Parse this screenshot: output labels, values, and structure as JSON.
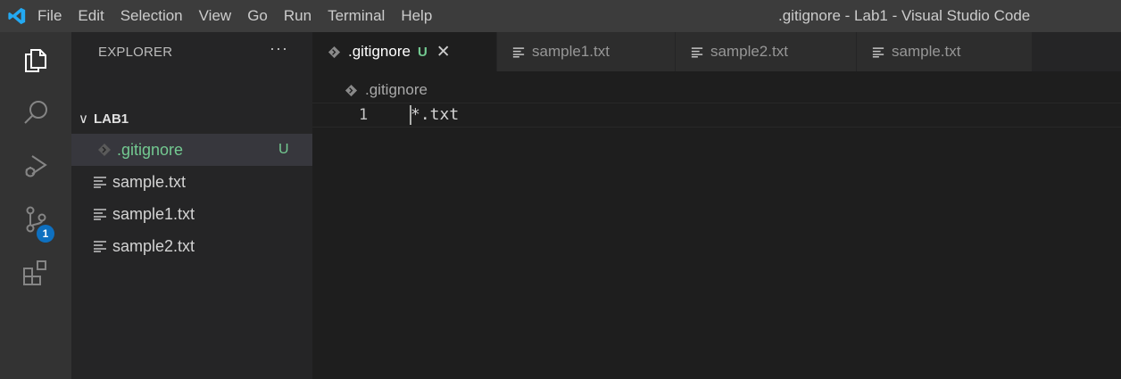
{
  "window": {
    "title": ".gitignore - Lab1 - Visual Studio Code"
  },
  "menu": {
    "items": [
      {
        "label": "File"
      },
      {
        "label": "Edit"
      },
      {
        "label": "Selection"
      },
      {
        "label": "View"
      },
      {
        "label": "Go"
      },
      {
        "label": "Run"
      },
      {
        "label": "Terminal"
      },
      {
        "label": "Help"
      }
    ]
  },
  "activity_bar": {
    "items": [
      {
        "icon": "explorer-icon"
      },
      {
        "icon": "search-icon"
      },
      {
        "icon": "run-debug-icon"
      },
      {
        "icon": "source-control-icon",
        "badge": "1"
      },
      {
        "icon": "extensions-icon"
      }
    ]
  },
  "sidebar": {
    "title": "EXPLORER",
    "more": "···",
    "folder": {
      "chevron": "∨",
      "name": "LAB1"
    },
    "files": [
      {
        "name": ".gitignore",
        "status": "U",
        "icon": "gitignore-file-icon"
      },
      {
        "name": "sample.txt",
        "status": "",
        "icon": "text-file-icon"
      },
      {
        "name": "sample1.txt",
        "status": "",
        "icon": "text-file-icon"
      },
      {
        "name": "sample2.txt",
        "status": "",
        "icon": "text-file-icon"
      }
    ]
  },
  "tabs": [
    {
      "label": ".gitignore",
      "status": "U",
      "close": "✕",
      "active": true
    },
    {
      "label": "sample1.txt"
    },
    {
      "label": "sample2.txt"
    },
    {
      "label": "sample.txt"
    }
  ],
  "editor": {
    "breadcrumb": ".gitignore",
    "lines": [
      {
        "number": "1",
        "text": "*.txt"
      }
    ]
  },
  "colors": {
    "git_untracked": "#73c991",
    "badge": "#0e70c0",
    "vscode_blue": "#23a9f2"
  }
}
